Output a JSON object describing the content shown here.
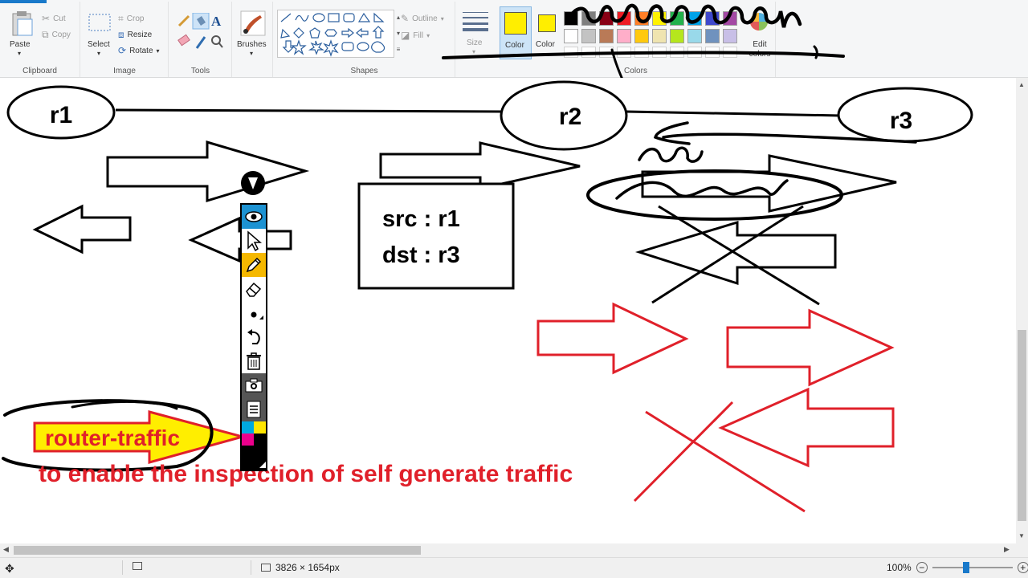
{
  "ribbon": {
    "clipboard": {
      "label": "Clipboard",
      "paste": "Paste",
      "cut": "Cut",
      "copy": "Copy"
    },
    "image": {
      "label": "Image",
      "select": "Select",
      "crop": "Crop",
      "resize": "Resize",
      "rotate": "Rotate"
    },
    "tools": {
      "label": "Tools"
    },
    "brushes": {
      "label": "Brushes"
    },
    "shapes": {
      "label": "Shapes",
      "outline": "Outline",
      "fill": "Fill"
    },
    "size": {
      "label": "Size"
    },
    "color1": {
      "label": "Color",
      "value": "#ffee00"
    },
    "color2": {
      "label": "Color",
      "value": "#ffee00"
    },
    "colors": {
      "label": "Colors",
      "edit": "Edit colors"
    },
    "palette_row1": [
      "#000000",
      "#7f7f7f",
      "#880015",
      "#ed1c24",
      "#ff7f27",
      "#fff200",
      "#22b14c",
      "#00a2e8",
      "#3f48cc",
      "#a349a4"
    ],
    "palette_row2": [
      "#ffffff",
      "#c3c3c3",
      "#b97a57",
      "#ffaec9",
      "#ffc90e",
      "#efe4b0",
      "#b5e61d",
      "#99d9ea",
      "#7092be",
      "#c8bfe7"
    ]
  },
  "canvas": {
    "nodes": {
      "r1": "r1",
      "r2": "r2",
      "r3": "r3"
    },
    "box_line1": "src : r1",
    "box_line2": "dst : r3",
    "router_traffic": "router-traffic",
    "note": "to enable the inspection of self generate traffic",
    "accent_red": "#e0202a",
    "highlight_yellow": "#ffee00"
  },
  "annotation_toolbar": {
    "icons": [
      "eye-icon",
      "pointer-icon",
      "pen-icon",
      "eraser-icon",
      "stroke-size-icon",
      "undo-icon",
      "trash-icon",
      "camera-icon",
      "notes-icon",
      "color-swatch-icon"
    ]
  },
  "status": {
    "dimensions": "3826 × 1654px",
    "zoom": "100%"
  }
}
